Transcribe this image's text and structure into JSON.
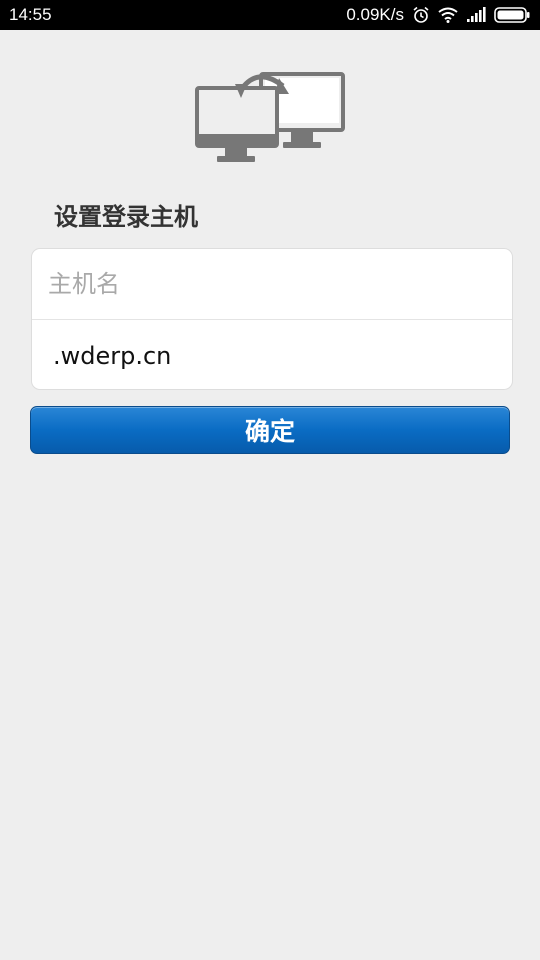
{
  "statusbar": {
    "time": "14:55",
    "net_speed": "0.09K/s",
    "icons": [
      "alarm-icon",
      "wifi-icon",
      "signal-icon",
      "battery-icon"
    ]
  },
  "header": {
    "logo_icon": "two-monitors-sync-icon",
    "title": "设置登录主机"
  },
  "form": {
    "host_placeholder": "主机名",
    "host_value": "",
    "domain_value": ".wderp.cn"
  },
  "actions": {
    "confirm_label": "确定"
  },
  "colors": {
    "background": "#eeeeee",
    "button_blue": "#0a6cc4",
    "statusbar": "#000000",
    "title_text": "#333333"
  }
}
